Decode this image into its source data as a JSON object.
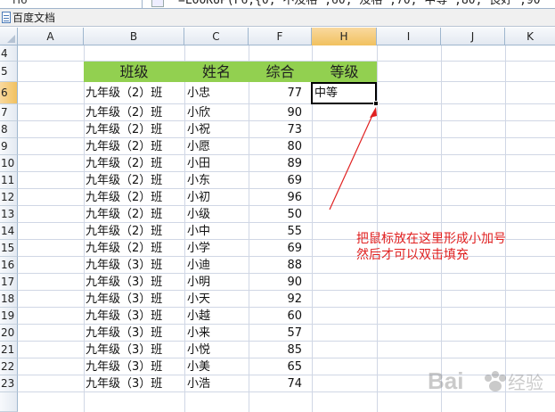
{
  "formula_bar": {
    "name_box": "H6",
    "formula": "=LOOKUP(F6,{0,\"不及格\";60,\"及格\";70,\"中等\";80,\"良好\";90"
  },
  "document": {
    "title": "百度文档"
  },
  "columns": [
    "A",
    "B",
    "C",
    "F",
    "H",
    "I",
    "J",
    "K"
  ],
  "active_column": "H",
  "active_row": "6",
  "rows": [
    "4",
    "5",
    "6",
    "7",
    "8",
    "9",
    "10",
    "11",
    "12",
    "13",
    "14",
    "15",
    "16",
    "17",
    "18",
    "19",
    "20",
    "21",
    "22",
    "23"
  ],
  "table": {
    "headers": {
      "class": "班级",
      "name": "姓名",
      "score": "综合",
      "grade": "等级"
    },
    "records": [
      {
        "class": "九年级（2）班",
        "name": "小忠",
        "score": "77",
        "grade": "中等"
      },
      {
        "class": "九年级（2）班",
        "name": "小欣",
        "score": "90",
        "grade": ""
      },
      {
        "class": "九年级（2）班",
        "name": "小祝",
        "score": "73",
        "grade": ""
      },
      {
        "class": "九年级（2）班",
        "name": "小愿",
        "score": "80",
        "grade": ""
      },
      {
        "class": "九年级（2）班",
        "name": "小田",
        "score": "89",
        "grade": ""
      },
      {
        "class": "九年级（2）班",
        "name": "小东",
        "score": "69",
        "grade": ""
      },
      {
        "class": "九年级（2）班",
        "name": "小初",
        "score": "96",
        "grade": ""
      },
      {
        "class": "九年级（2）班",
        "name": "小级",
        "score": "50",
        "grade": ""
      },
      {
        "class": "九年级（2）班",
        "name": "小中",
        "score": "55",
        "grade": ""
      },
      {
        "class": "九年级（2）班",
        "name": "小学",
        "score": "69",
        "grade": ""
      },
      {
        "class": "九年级（3）班",
        "name": "小迪",
        "score": "88",
        "grade": ""
      },
      {
        "class": "九年级（3）班",
        "name": "小明",
        "score": "90",
        "grade": ""
      },
      {
        "class": "九年级（3）班",
        "name": "小天",
        "score": "92",
        "grade": ""
      },
      {
        "class": "九年级（3）班",
        "name": "小越",
        "score": "60",
        "grade": ""
      },
      {
        "class": "九年级（3）班",
        "name": "小来",
        "score": "57",
        "grade": ""
      },
      {
        "class": "九年级（3）班",
        "name": "小悦",
        "score": "85",
        "grade": ""
      },
      {
        "class": "九年级（3）班",
        "name": "小美",
        "score": "65",
        "grade": ""
      },
      {
        "class": "九年级（3）班",
        "name": "小浩",
        "score": "74",
        "grade": ""
      }
    ]
  },
  "annotation": {
    "line1": "把鼠标放在这里形成小加号",
    "line2": "然后才可以双击填充",
    "color": "#e02020"
  },
  "watermark": {
    "text": "Bai",
    "suffix": "经验",
    "logo": "baidu-paw-icon"
  },
  "colors": {
    "header_fill": "#92d050",
    "active_header": "#f1c15f"
  }
}
